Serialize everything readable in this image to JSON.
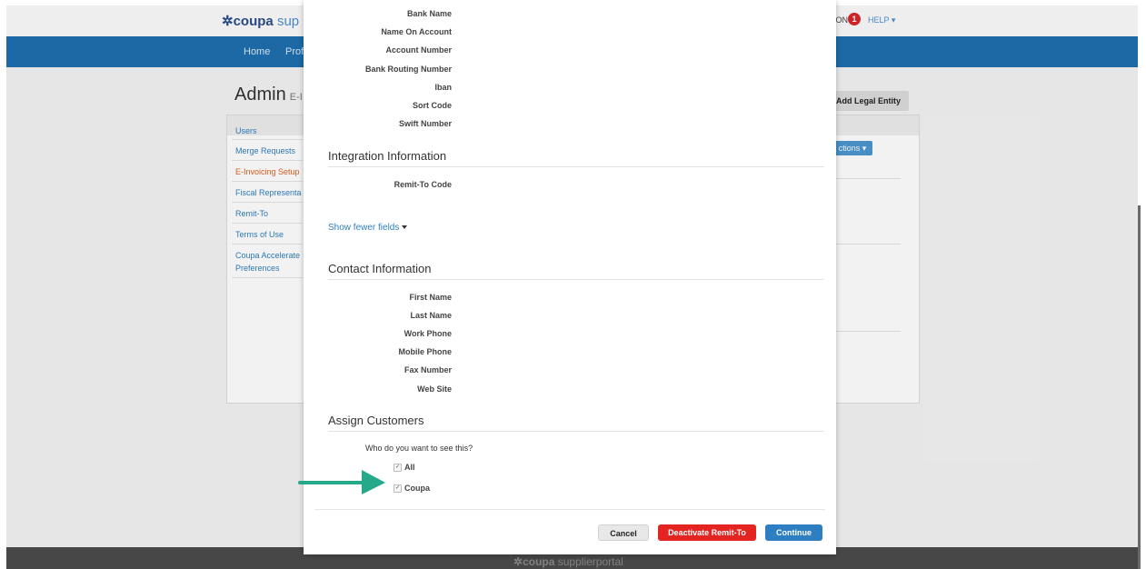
{
  "topbar": {
    "logo_brand": "coupa",
    "logo_sub": "sup",
    "notifications_label": "IONS",
    "notifications_count": "1",
    "help_label": "HELP ▾"
  },
  "nav": {
    "items": [
      "Home",
      "Prof"
    ]
  },
  "admin": {
    "title": "Admin",
    "subtitle": "E-I",
    "add_legal_entity": "Add Legal Entity",
    "actions_label": "ctions ▾"
  },
  "sidebar": {
    "items": [
      "Users",
      "Merge Requests",
      "E-Invoicing Setup",
      "Fiscal Representa",
      "Remit-To",
      "Terms of Use",
      "Coupa Accelerate",
      "Preferences"
    ]
  },
  "footer": {
    "logo_brand": "coupa",
    "logo_sub": "supplierportal"
  },
  "modal": {
    "bank_fields": [
      "Bank Name",
      "Name On Account",
      "Account Number",
      "Bank Routing Number",
      "Iban",
      "Sort Code",
      "Swift Number"
    ],
    "integration_title": "Integration Information",
    "integration_fields": [
      "Remit-To Code"
    ],
    "show_fewer": "Show fewer fields",
    "contact_title": "Contact Information",
    "contact_fields": [
      "First Name",
      "Last Name",
      "Work Phone",
      "Mobile Phone",
      "Fax Number",
      "Web Site"
    ],
    "assign_title": "Assign Customers",
    "who_question": "Who do you want to see this?",
    "customers": [
      {
        "label": "All",
        "checked": true
      },
      {
        "label": "Coupa",
        "checked": true
      }
    ],
    "cancel_label": "Cancel",
    "deactivate_label": "Deactivate Remit-To",
    "continue_label": "Continue"
  },
  "colors": {
    "accent_blue": "#1e6fae",
    "danger_red": "#e32420",
    "arrow_teal": "#26a98a"
  }
}
